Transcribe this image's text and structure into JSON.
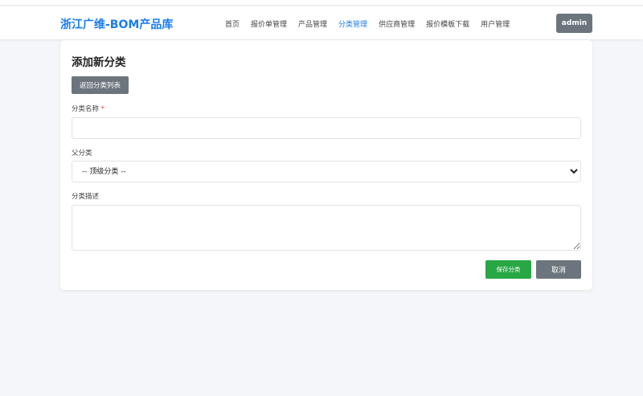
{
  "header": {
    "logo": "浙江广维-BOM产品库",
    "nav": [
      "首页",
      "报价单管理",
      "产品管理",
      "分类管理",
      "供应商管理",
      "报价模板下载",
      "用户管理"
    ],
    "active_nav": "分类管理",
    "user": "admin"
  },
  "form": {
    "title": "添加新分类",
    "back_label": "返回分类列表",
    "name_label": "分类名称",
    "required_mark": "*",
    "name_value": "",
    "parent_label": "父分类",
    "parent_selected": "-- 顶级分类 --",
    "desc_label": "分类描述",
    "desc_value": "",
    "save_label": "保存分类",
    "cancel_label": "取消"
  },
  "colors": {
    "brand": "#1a7cf0",
    "success": "#28a745",
    "secondary": "#6c757d"
  }
}
